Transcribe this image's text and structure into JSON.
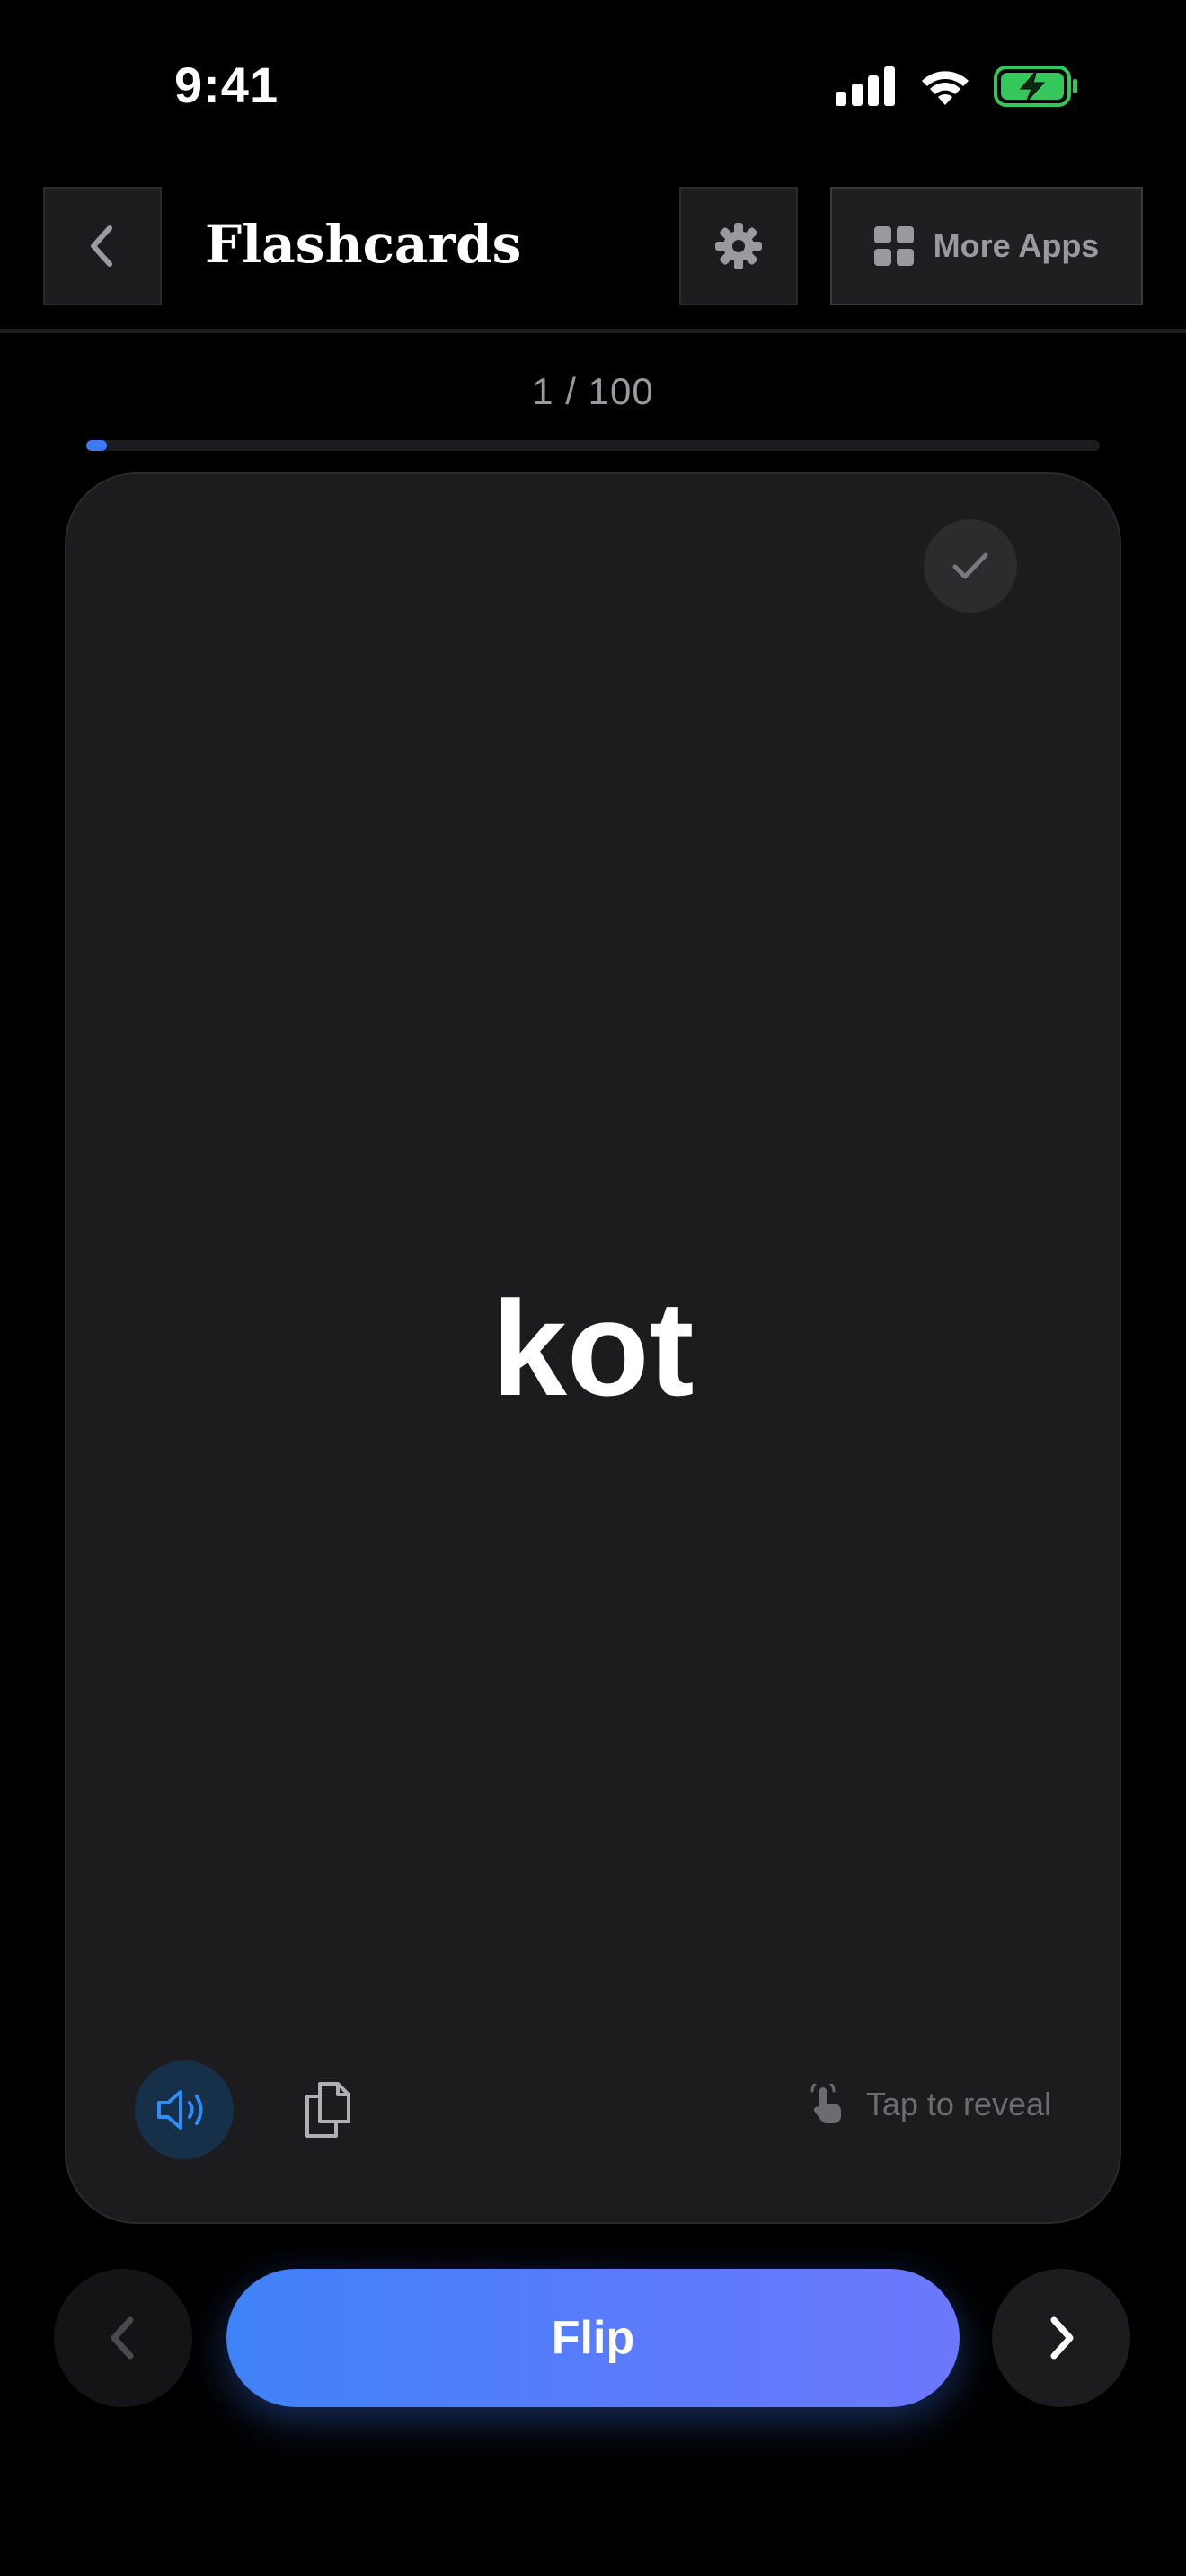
{
  "status_bar": {
    "time": "9:41",
    "icons": [
      "signal-icon",
      "wifi-icon",
      "battery-charging-icon"
    ]
  },
  "header": {
    "title": "Flashcards",
    "more_apps_label": "More Apps",
    "icons": [
      "chevron-left-icon",
      "gear-icon",
      "grid-icon"
    ]
  },
  "progress": {
    "text": "1 / 100",
    "current": 1,
    "total": 100,
    "fraction": 0.02
  },
  "card": {
    "word": "kot",
    "tap_hint": "Tap to reveal",
    "icons": [
      "check-icon",
      "speaker-icon",
      "copy-icon",
      "tap-hand-icon"
    ]
  },
  "nav": {
    "flip_label": "Flip",
    "icons": [
      "chevron-left-icon",
      "chevron-right-icon"
    ]
  },
  "colors": {
    "background": "#000000",
    "card": "#1c1c1e",
    "accent_blue": "#3f82f7",
    "accent_purple": "#6c78fc",
    "battery_green": "#34c759",
    "muted_text": "#9a9a9e"
  }
}
